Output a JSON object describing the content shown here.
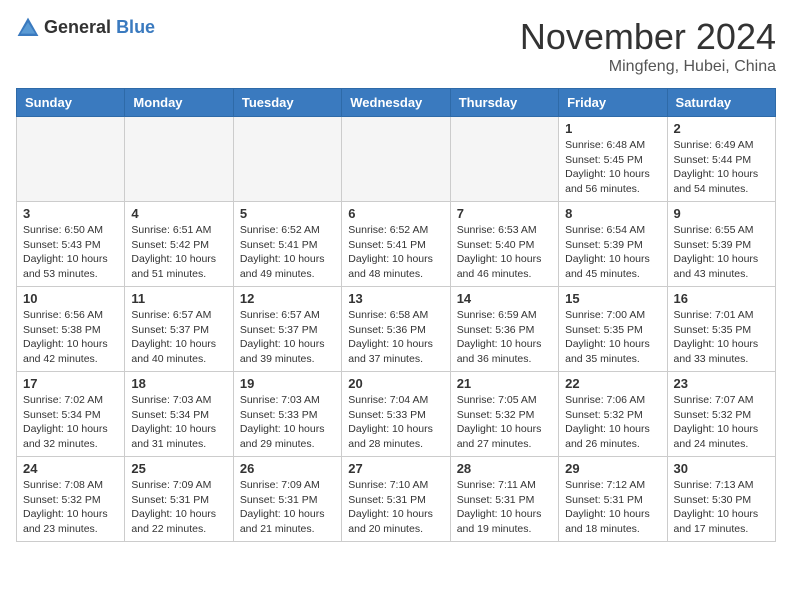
{
  "header": {
    "logo_general": "General",
    "logo_blue": "Blue",
    "month_title": "November 2024",
    "subtitle": "Mingfeng, Hubei, China"
  },
  "days_of_week": [
    "Sunday",
    "Monday",
    "Tuesday",
    "Wednesday",
    "Thursday",
    "Friday",
    "Saturday"
  ],
  "weeks": [
    [
      {
        "day": "",
        "info": ""
      },
      {
        "day": "",
        "info": ""
      },
      {
        "day": "",
        "info": ""
      },
      {
        "day": "",
        "info": ""
      },
      {
        "day": "",
        "info": ""
      },
      {
        "day": "1",
        "info": "Sunrise: 6:48 AM\nSunset: 5:45 PM\nDaylight: 10 hours and 56 minutes."
      },
      {
        "day": "2",
        "info": "Sunrise: 6:49 AM\nSunset: 5:44 PM\nDaylight: 10 hours and 54 minutes."
      }
    ],
    [
      {
        "day": "3",
        "info": "Sunrise: 6:50 AM\nSunset: 5:43 PM\nDaylight: 10 hours and 53 minutes."
      },
      {
        "day": "4",
        "info": "Sunrise: 6:51 AM\nSunset: 5:42 PM\nDaylight: 10 hours and 51 minutes."
      },
      {
        "day": "5",
        "info": "Sunrise: 6:52 AM\nSunset: 5:41 PM\nDaylight: 10 hours and 49 minutes."
      },
      {
        "day": "6",
        "info": "Sunrise: 6:52 AM\nSunset: 5:41 PM\nDaylight: 10 hours and 48 minutes."
      },
      {
        "day": "7",
        "info": "Sunrise: 6:53 AM\nSunset: 5:40 PM\nDaylight: 10 hours and 46 minutes."
      },
      {
        "day": "8",
        "info": "Sunrise: 6:54 AM\nSunset: 5:39 PM\nDaylight: 10 hours and 45 minutes."
      },
      {
        "day": "9",
        "info": "Sunrise: 6:55 AM\nSunset: 5:39 PM\nDaylight: 10 hours and 43 minutes."
      }
    ],
    [
      {
        "day": "10",
        "info": "Sunrise: 6:56 AM\nSunset: 5:38 PM\nDaylight: 10 hours and 42 minutes."
      },
      {
        "day": "11",
        "info": "Sunrise: 6:57 AM\nSunset: 5:37 PM\nDaylight: 10 hours and 40 minutes."
      },
      {
        "day": "12",
        "info": "Sunrise: 6:57 AM\nSunset: 5:37 PM\nDaylight: 10 hours and 39 minutes."
      },
      {
        "day": "13",
        "info": "Sunrise: 6:58 AM\nSunset: 5:36 PM\nDaylight: 10 hours and 37 minutes."
      },
      {
        "day": "14",
        "info": "Sunrise: 6:59 AM\nSunset: 5:36 PM\nDaylight: 10 hours and 36 minutes."
      },
      {
        "day": "15",
        "info": "Sunrise: 7:00 AM\nSunset: 5:35 PM\nDaylight: 10 hours and 35 minutes."
      },
      {
        "day": "16",
        "info": "Sunrise: 7:01 AM\nSunset: 5:35 PM\nDaylight: 10 hours and 33 minutes."
      }
    ],
    [
      {
        "day": "17",
        "info": "Sunrise: 7:02 AM\nSunset: 5:34 PM\nDaylight: 10 hours and 32 minutes."
      },
      {
        "day": "18",
        "info": "Sunrise: 7:03 AM\nSunset: 5:34 PM\nDaylight: 10 hours and 31 minutes."
      },
      {
        "day": "19",
        "info": "Sunrise: 7:03 AM\nSunset: 5:33 PM\nDaylight: 10 hours and 29 minutes."
      },
      {
        "day": "20",
        "info": "Sunrise: 7:04 AM\nSunset: 5:33 PM\nDaylight: 10 hours and 28 minutes."
      },
      {
        "day": "21",
        "info": "Sunrise: 7:05 AM\nSunset: 5:32 PM\nDaylight: 10 hours and 27 minutes."
      },
      {
        "day": "22",
        "info": "Sunrise: 7:06 AM\nSunset: 5:32 PM\nDaylight: 10 hours and 26 minutes."
      },
      {
        "day": "23",
        "info": "Sunrise: 7:07 AM\nSunset: 5:32 PM\nDaylight: 10 hours and 24 minutes."
      }
    ],
    [
      {
        "day": "24",
        "info": "Sunrise: 7:08 AM\nSunset: 5:32 PM\nDaylight: 10 hours and 23 minutes."
      },
      {
        "day": "25",
        "info": "Sunrise: 7:09 AM\nSunset: 5:31 PM\nDaylight: 10 hours and 22 minutes."
      },
      {
        "day": "26",
        "info": "Sunrise: 7:09 AM\nSunset: 5:31 PM\nDaylight: 10 hours and 21 minutes."
      },
      {
        "day": "27",
        "info": "Sunrise: 7:10 AM\nSunset: 5:31 PM\nDaylight: 10 hours and 20 minutes."
      },
      {
        "day": "28",
        "info": "Sunrise: 7:11 AM\nSunset: 5:31 PM\nDaylight: 10 hours and 19 minutes."
      },
      {
        "day": "29",
        "info": "Sunrise: 7:12 AM\nSunset: 5:31 PM\nDaylight: 10 hours and 18 minutes."
      },
      {
        "day": "30",
        "info": "Sunrise: 7:13 AM\nSunset: 5:30 PM\nDaylight: 10 hours and 17 minutes."
      }
    ]
  ]
}
